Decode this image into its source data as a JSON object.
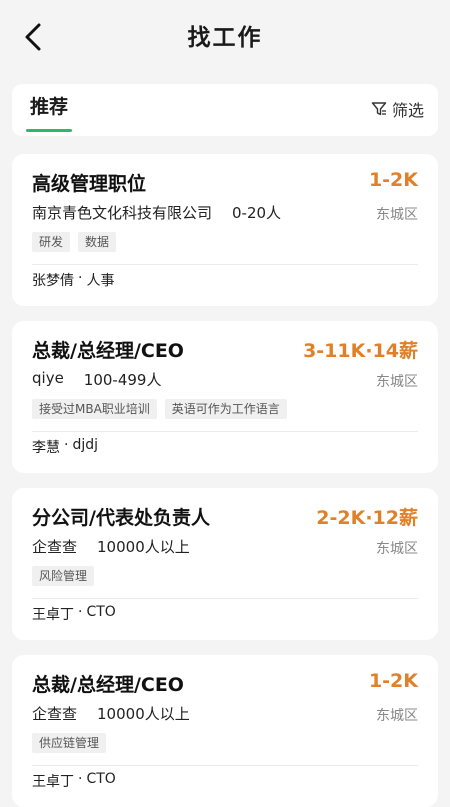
{
  "header": {
    "title": "找工作",
    "back_icon": "back-arrow-icon"
  },
  "tabs": {
    "active_label": "推荐",
    "filter_label": "筛选",
    "filter_icon": "filter-funnel-icon",
    "accent": "#2eb86b"
  },
  "colors": {
    "salary": "#e0812a",
    "background": "#f4f4f4"
  },
  "jobs": [
    {
      "title": "高级管理职位",
      "salary": "1-2K",
      "company": "南京青色文化科技有限公司",
      "size": "0-20人",
      "district": "东城区",
      "tags": [
        "研发",
        "数据"
      ],
      "recruiter": "张梦倩",
      "role": "人事"
    },
    {
      "title": "总裁/总经理/CEO",
      "salary": "3-11K·14薪",
      "company": "qiye",
      "size": "100-499人",
      "district": "东城区",
      "tags": [
        "接受过MBA职业培训",
        "英语可作为工作语言"
      ],
      "recruiter": "李慧",
      "role": "djdj"
    },
    {
      "title": "分公司/代表处负责人",
      "salary": "2-2K·12薪",
      "company": "企查查",
      "size": "10000人以上",
      "district": "东城区",
      "tags": [
        "风险管理"
      ],
      "recruiter": "王卓丁",
      "role": "CTO"
    },
    {
      "title": "总裁/总经理/CEO",
      "salary": "1-2K",
      "company": "企查查",
      "size": "10000人以上",
      "district": "东城区",
      "tags": [
        "供应链管理"
      ],
      "recruiter": "王卓丁",
      "role": "CTO"
    }
  ]
}
